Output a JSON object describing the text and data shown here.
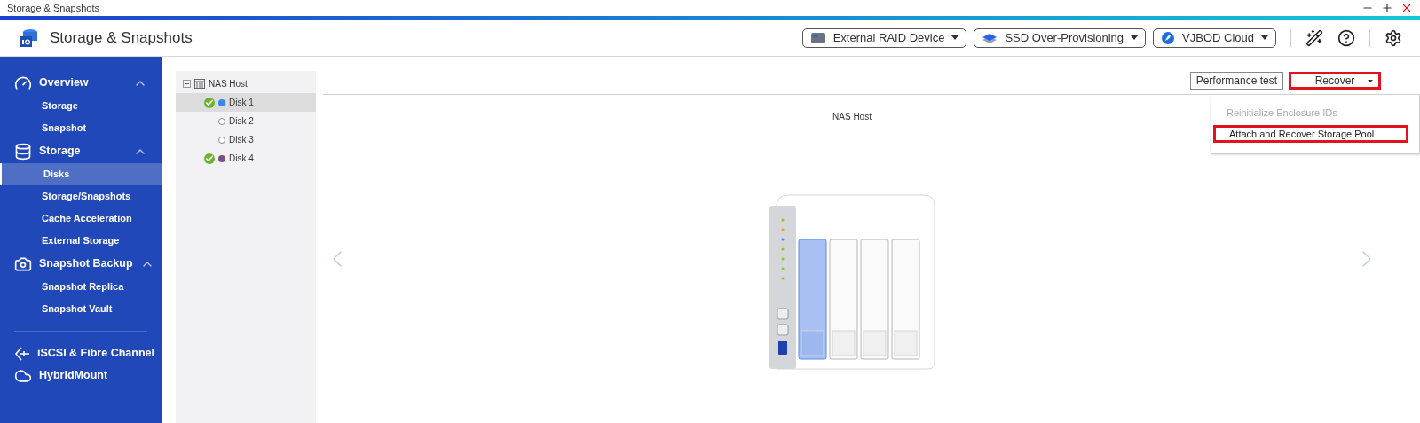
{
  "window": {
    "title": "Storage & Snapshots"
  },
  "header": {
    "title": "Storage & Snapshots",
    "tools": [
      {
        "kind": "raid",
        "label": "External RAID Device"
      },
      {
        "kind": "ssd",
        "label": "SSD Over-Provisioning"
      },
      {
        "kind": "cloud",
        "label": "VJBOD Cloud"
      }
    ]
  },
  "sidebar": {
    "groups": [
      {
        "kind": "gauge",
        "label": "Overview",
        "expanded": true,
        "items": [
          {
            "label": "Storage",
            "selected": false
          },
          {
            "label": "Snapshot",
            "selected": false
          }
        ]
      },
      {
        "kind": "database",
        "label": "Storage",
        "expanded": true,
        "items": [
          {
            "label": "Disks",
            "selected": true
          },
          {
            "label": "Storage/Snapshots",
            "selected": false
          },
          {
            "label": "Cache Acceleration",
            "selected": false
          },
          {
            "label": "External Storage",
            "selected": false
          }
        ]
      },
      {
        "kind": "camera",
        "label": "Snapshot Backup",
        "expanded": true,
        "items": [
          {
            "label": "Snapshot Replica",
            "selected": false
          },
          {
            "label": "Snapshot Vault",
            "selected": false
          }
        ]
      }
    ],
    "links": [
      {
        "kind": "iscsi",
        "label": "iSCSI & Fibre Channel"
      },
      {
        "kind": "cloud",
        "label": "HybridMount"
      }
    ]
  },
  "tree": {
    "label": "NAS Host",
    "expanded": true,
    "disks": [
      {
        "label": "Disk 1",
        "selected": true,
        "healthy": true,
        "color": "#3b82f6"
      },
      {
        "label": "Disk 2",
        "selected": false,
        "healthy": false
      },
      {
        "label": "Disk 3",
        "selected": false,
        "healthy": false
      },
      {
        "label": "Disk 4",
        "selected": false,
        "healthy": true,
        "color": "#7a4f8a"
      }
    ]
  },
  "toolbar": {
    "buttons": [
      {
        "kind": "plain",
        "label": "Performance test",
        "highlighted": false
      },
      {
        "kind": "menu",
        "label": "Recover",
        "highlighted": true
      }
    ],
    "menu": [
      {
        "label": "Reinitialize Enclosure IDs",
        "disabled": true,
        "highlighted": false
      },
      {
        "label": "Attach and Recover Storage Pool",
        "disabled": false,
        "highlighted": true
      }
    ]
  },
  "device": {
    "title": "NAS Host"
  }
}
